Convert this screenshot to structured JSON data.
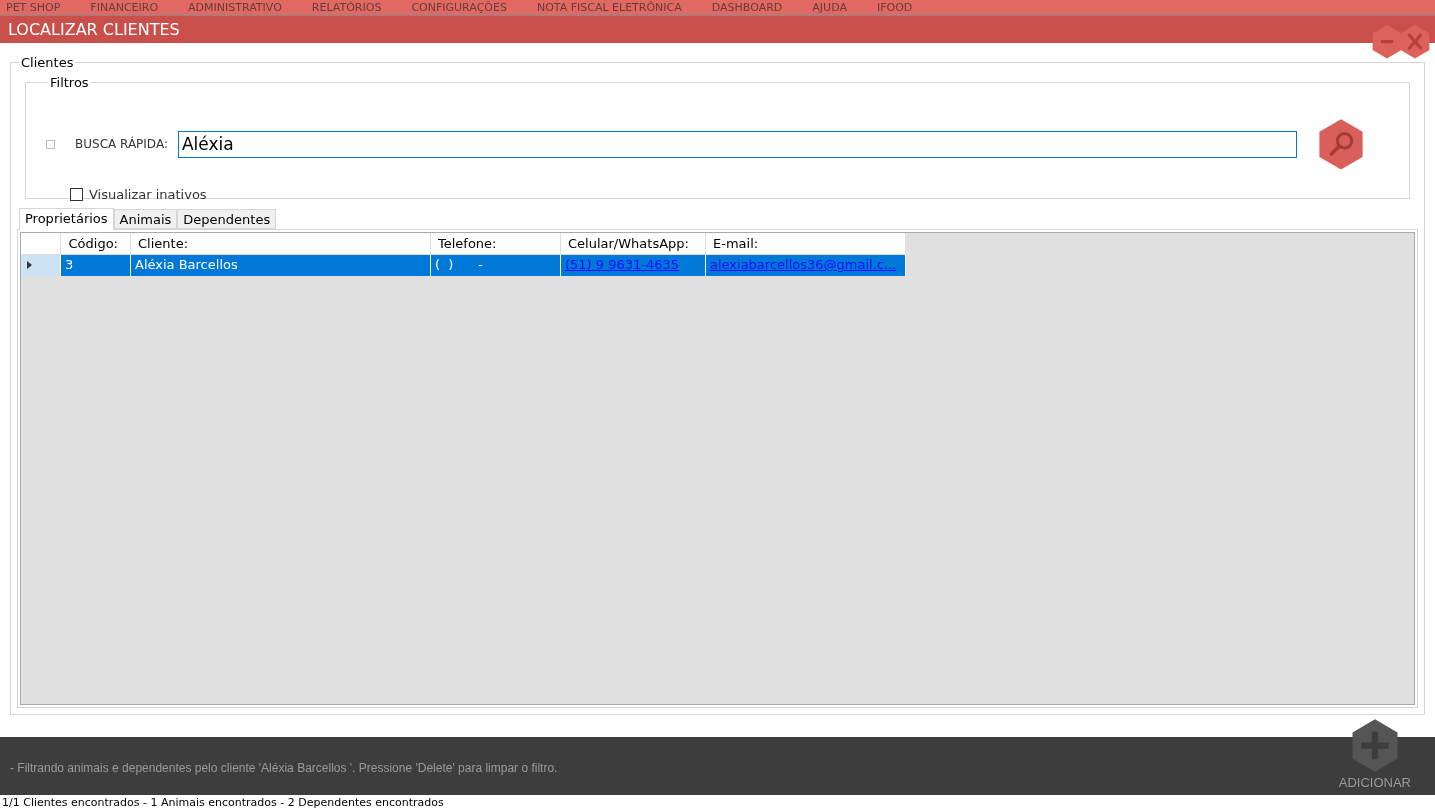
{
  "menu": [
    "PET SHOP",
    "FINANCEIRO",
    "ADMINISTRATIVO",
    "RELATÓRIOS",
    "CONFIGURAÇÕES",
    "NOTA FISCAL ELETRÔNICA",
    "DASHBOARD",
    "AJUDA",
    "IFOOD"
  ],
  "window": {
    "title": "LOCALIZAR CLIENTES"
  },
  "group": "Clientes",
  "filters": {
    "title": "Filtros",
    "label": "BUSCA RÁPIDA:",
    "value": "Aléxia",
    "show_inactive": {
      "label": "Visualizar inativos",
      "checked": false
    }
  },
  "tabs": [
    {
      "label": "Proprietários",
      "selected": true
    },
    {
      "label": "Animais",
      "selected": false
    },
    {
      "label": "Dependentes",
      "selected": false
    }
  ],
  "table": {
    "columns": [
      "Código:",
      "Cliente:",
      "Telefone:",
      "Celular/WhatsApp:",
      "E-mail:"
    ],
    "rows": [
      {
        "selected": true,
        "cells": [
          "3",
          "Aléxia Barcellos",
          "(  )      -",
          "(51) 9 9631-4635",
          "alexiabarcellos36@gmail.c..."
        ]
      }
    ]
  },
  "footer": {
    "message": "- Filtrando animais e dependentes pelo cliente 'Aléxia Barcellos '. Pressione 'Delete' para limpar o filtro.",
    "add_label": "ADICIONAR"
  },
  "status": "1/1 Clientes encontrados - 1 Animais encontrados - 2 Dependentes encontrados"
}
